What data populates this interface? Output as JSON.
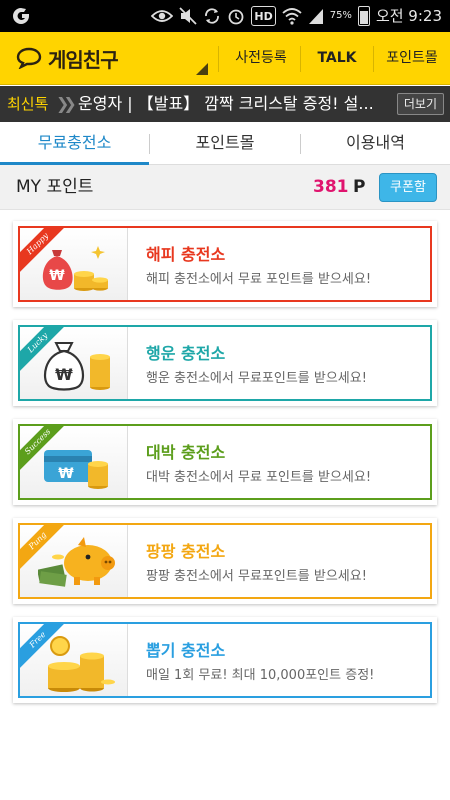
{
  "status_bar": {
    "battery_pct": "75%",
    "time": "오전 9:23",
    "icons": [
      "carrier-logo-icon",
      "eye-icon",
      "mute-icon",
      "sync-icon",
      "alarm-icon",
      "hd-icon",
      "wifi-icon",
      "signal-icon",
      "battery-icon"
    ],
    "hd_label": "HD"
  },
  "header": {
    "logo_text": "게임친구",
    "nav": [
      "사전등록",
      "TALK",
      "포인트몰"
    ]
  },
  "ticker": {
    "tag": "최신톡",
    "text": "운영자 | 【발표】 깜짝 크리스탈 증정! 설...",
    "more": "더보기"
  },
  "tabs": [
    "무료충전소",
    "포인트몰",
    "이용내역"
  ],
  "active_tab": 0,
  "my_point": {
    "label": "MY 포인트",
    "value": "381",
    "unit": "P",
    "coupon_button": "쿠폰함"
  },
  "cards": [
    {
      "ribbon": "Happy",
      "title": "해피 충전소",
      "desc": "해피 충전소에서 무료 포인트를 받으세요!",
      "color": "#e8381f",
      "icon": "money-bag-coins-icon"
    },
    {
      "ribbon": "Lucky",
      "title": "행운 충전소",
      "desc": "행운 충전소에서 무료포인트를 받으세요!",
      "color": "#1ea7a8",
      "icon": "won-sack-coins-icon"
    },
    {
      "ribbon": "Success",
      "title": "대박 충전소",
      "desc": "대박 충전소에서 무료 포인트를 받으세요!",
      "color": "#5c9e1c",
      "icon": "card-coins-icon"
    },
    {
      "ribbon": "Pung",
      "title": "팡팡 충전소",
      "desc": "팡팡 충전소에서 무료포인트를 받으세요!",
      "color": "#f3a712",
      "icon": "piggy-bank-cash-icon"
    },
    {
      "ribbon": "Free",
      "title": "뽑기 충전소",
      "desc": "매일 1회 무료! 최대 10,000포인트 증정!",
      "color": "#2a9fe0",
      "icon": "gold-coins-icon"
    }
  ]
}
